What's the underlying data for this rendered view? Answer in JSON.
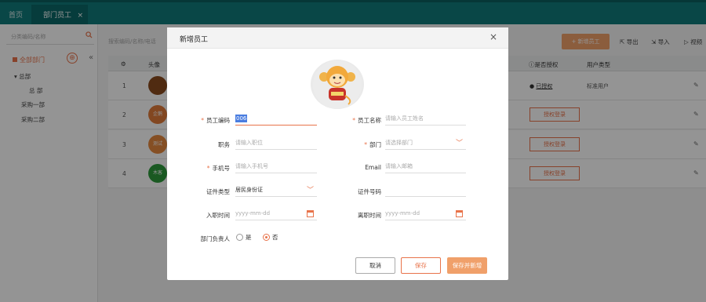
{
  "tabs": [
    {
      "label": "首页"
    },
    {
      "label": "部门员工",
      "close": "×"
    }
  ],
  "sidebar": {
    "search_placeholder": "分类编码/名称",
    "all_label": "全部部门",
    "add": "⊕",
    "collapse": "«",
    "tree": [
      {
        "label": "总部",
        "toggle": "▾"
      },
      {
        "label": "总 部"
      },
      {
        "label": "采购一部"
      },
      {
        "label": "采购二部"
      }
    ]
  },
  "main": {
    "search_placeholder": "搜索编码/名称/电话",
    "add_employee": "+ 新增员工",
    "export": "导出",
    "import": "导入",
    "video": "视频",
    "columns": {
      "settings": "⚙",
      "avatar": "头像",
      "authorized": "是否授权",
      "user_type": "用户类型"
    },
    "rows": [
      {
        "num": "1",
        "avatar_text": "",
        "avatar_color": "#8a4a1e",
        "auth": "已授权",
        "role": "标准用户"
      },
      {
        "num": "2",
        "avatar_text": "企鹅",
        "avatar_color": "#e07a3a",
        "auth": "授权登录",
        "role": ""
      },
      {
        "num": "3",
        "avatar_text": "测试",
        "avatar_color": "#e6893f",
        "auth": "授权登录",
        "role": ""
      },
      {
        "num": "4",
        "avatar_text": "木客",
        "avatar_color": "#2d9a3c",
        "auth": "授权登录",
        "role": ""
      }
    ]
  },
  "modal": {
    "title": "新增员工",
    "close": "×",
    "fields": {
      "emp_code": {
        "label": "员工编码",
        "value": "006"
      },
      "emp_name": {
        "label": "员工名称",
        "placeholder": "请输入员工姓名"
      },
      "position": {
        "label": "职务",
        "placeholder": "请输入职位"
      },
      "department": {
        "label": "部门",
        "placeholder": "请选择部门"
      },
      "phone": {
        "label": "手机号",
        "placeholder": "请输入手机号"
      },
      "email": {
        "label": "Email",
        "placeholder": "请输入邮箱"
      },
      "id_type": {
        "label": "证件类型",
        "value": "居民身份证"
      },
      "id_number": {
        "label": "证件号码",
        "value": ""
      },
      "join_date": {
        "label": "入职时间",
        "placeholder": "yyyy-mm-dd"
      },
      "leave_date": {
        "label": "离职时间",
        "placeholder": "yyyy-mm-dd"
      }
    },
    "manager": {
      "label": "部门负责人",
      "yes": "是",
      "no": "否",
      "selected": "否"
    },
    "buttons": {
      "cancel": "取消",
      "save": "保存",
      "save_new": "保存并新增"
    }
  },
  "colors": {
    "teal": "#107a7a",
    "accent": "#e8734a",
    "accent_light": "#f0a06a"
  }
}
